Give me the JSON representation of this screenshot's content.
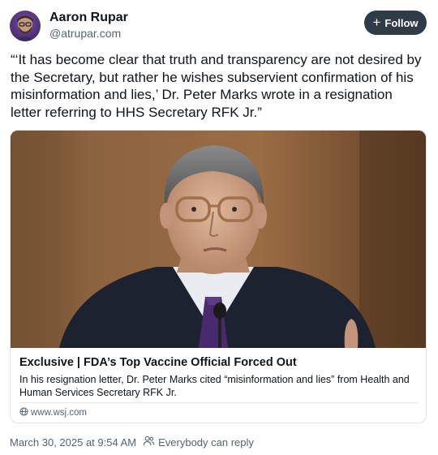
{
  "author": {
    "name": "Aaron Rupar",
    "handle": "@atrupar.com"
  },
  "follow_button": {
    "label": "Follow",
    "icon": "plus-icon"
  },
  "post": {
    "text": "“‘It has become clear that truth and transparency are not desired by the Secretary, but rather he wishes subservient confirmation of his misinformation and lies,’ Dr. Peter Marks wrote in a resignation letter referring to HHS Secretary RFK Jr.”"
  },
  "link_card": {
    "image_description": "photo-of-man-with-glasses",
    "title": "Exclusive | FDA’s Top Vaccine Official Forced Out",
    "description": "In his resignation letter, Dr. Peter Marks cited “misinformation and lies” from Health and Human Services Secretary RFK Jr.",
    "domain": "www.wsj.com",
    "domain_icon": "globe-icon"
  },
  "footer": {
    "timestamp": "March 30, 2025 at 9:54 AM",
    "reply_setting": "Everybody can reply",
    "reply_icon": "people-icon"
  },
  "colors": {
    "follow_bg": "#2f3b47",
    "muted_text": "#536471",
    "border": "#dfe3e7"
  }
}
